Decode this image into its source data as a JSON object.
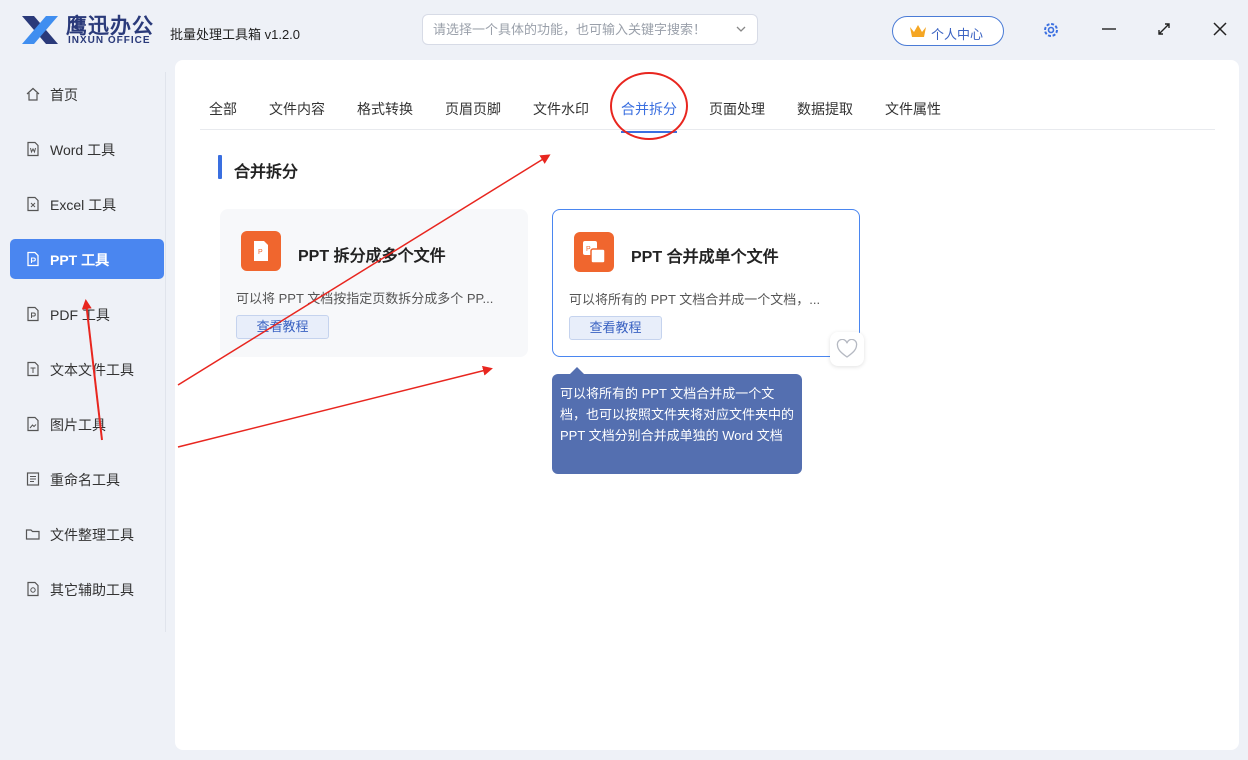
{
  "brand": {
    "name_cn": "鹰迅办公",
    "name_en": "INXUN OFFICE"
  },
  "app_title": "批量处理工具箱 v1.2.0",
  "search": {
    "placeholder": "请选择一个具体的功能，也可输入关键字搜索！"
  },
  "header": {
    "user_center_label": "个人中心"
  },
  "icons": {
    "logo": "logo-icon",
    "chevron": "chevron-down-icon",
    "crown": "crown-icon",
    "settings": "gear-icon",
    "minimize": "minimize-icon",
    "maximize": "maximize-icon",
    "close": "close-icon"
  },
  "sidebar": {
    "items": [
      {
        "label": "首页",
        "icon": "home-icon",
        "active": false
      },
      {
        "label": "Word 工具",
        "icon": "word-file-icon",
        "active": false
      },
      {
        "label": "Excel 工具",
        "icon": "excel-file-icon",
        "active": false
      },
      {
        "label": "PPT 工具",
        "icon": "ppt-file-icon",
        "active": true
      },
      {
        "label": "PDF 工具",
        "icon": "pdf-file-icon",
        "active": false
      },
      {
        "label": "文本文件工具",
        "icon": "text-file-icon",
        "active": false
      },
      {
        "label": "图片工具",
        "icon": "image-file-icon",
        "active": false
      },
      {
        "label": "重命名工具",
        "icon": "rename-icon",
        "active": false
      },
      {
        "label": "文件整理工具",
        "icon": "folder-icon",
        "active": false
      },
      {
        "label": "其它辅助工具",
        "icon": "misc-tools-icon",
        "active": false
      }
    ]
  },
  "tabs": [
    {
      "label": "全部",
      "active": false
    },
    {
      "label": "文件内容",
      "active": false
    },
    {
      "label": "格式转换",
      "active": false
    },
    {
      "label": "页眉页脚",
      "active": false
    },
    {
      "label": "文件水印",
      "active": false
    },
    {
      "label": "合并拆分",
      "active": true
    },
    {
      "label": "页面处理",
      "active": false
    },
    {
      "label": "数据提取",
      "active": false
    },
    {
      "label": "文件属性",
      "active": false
    }
  ],
  "section": {
    "title": "合并拆分"
  },
  "cards": [
    {
      "title": "PPT 拆分成多个文件",
      "description": "可以将 PPT 文档按指定页数拆分成多个 PP...",
      "tutorial_label": "查看教程",
      "icon": "ppt-split-icon"
    },
    {
      "title": "PPT 合并成单个文件",
      "description": "可以将所有的 PPT 文档合并成一个文档，...",
      "tutorial_label": "查看教程",
      "icon": "ppt-merge-icon"
    }
  ],
  "favorite": {
    "icon": "heart-icon"
  },
  "tooltip": {
    "text": "可以将所有的 PPT 文档合并成一个文档，也可以按照文件夹将对应文件夹中的 PPT 文档分别合并成单独的 Word 文档"
  },
  "colors": {
    "accent": "#4a86f0",
    "annotation": "#e8261f",
    "ppt_orange": "#f0662e",
    "tooltip_bg": "#546fb0"
  }
}
